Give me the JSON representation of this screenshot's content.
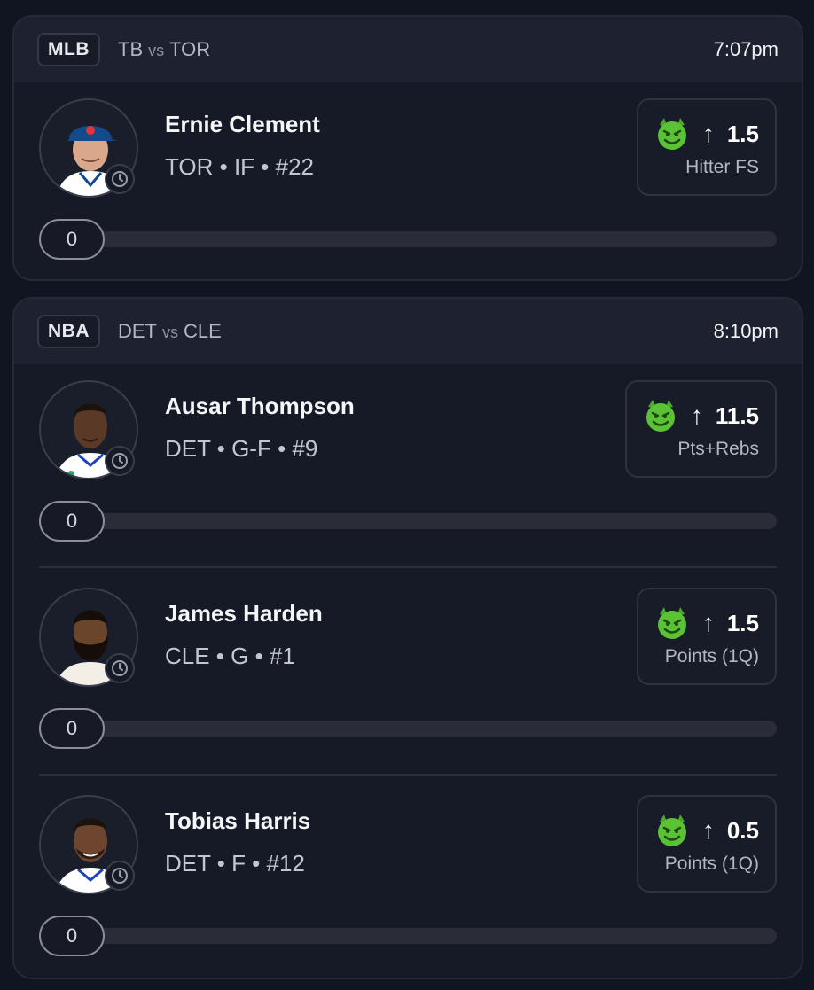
{
  "games": [
    {
      "league": "MLB",
      "team_a": "TB",
      "vs": "vs",
      "team_b": "TOR",
      "time": "7:07pm",
      "players": [
        {
          "name": "Ernie Clement",
          "info": "TOR • IF • #22",
          "pick_direction_icon": "arrow-up-icon",
          "pick_line": "1.5",
          "pick_stat": "Hitter FS",
          "progress_value": "0",
          "progress_fraction": 0,
          "jersey_color": "#ffffff",
          "cap_color": "#134a8e"
        }
      ]
    },
    {
      "league": "NBA",
      "team_a": "DET",
      "vs": "vs",
      "team_b": "CLE",
      "time": "8:10pm",
      "players": [
        {
          "name": "Ausar Thompson",
          "info": "DET • G-F • #9",
          "pick_direction_icon": "arrow-up-icon",
          "pick_line": "11.5",
          "pick_stat": "Pts+Rebs",
          "progress_value": "0",
          "progress_fraction": 0,
          "jersey_color": "#ffffff"
        },
        {
          "name": "James Harden",
          "info": "CLE • G • #1",
          "pick_direction_icon": "arrow-up-icon",
          "pick_line": "1.5",
          "pick_stat": "Points (1Q)",
          "progress_value": "0",
          "progress_fraction": 0,
          "jersey_color": "#f3efe6"
        },
        {
          "name": "Tobias Harris",
          "info": "DET • F • #12",
          "pick_direction_icon": "arrow-up-icon",
          "pick_line": "0.5",
          "pick_stat": "Points (1Q)",
          "progress_value": "0",
          "progress_fraction": 0,
          "jersey_color": "#ffffff"
        }
      ]
    }
  ],
  "colors": {
    "background": "#111521",
    "card": "#161a27",
    "header": "#1e2230",
    "demon_green": "#5bc236",
    "progress_track": "#2a2d38"
  },
  "icons": {
    "pick_badge": "demon-face-icon",
    "status": "clock-icon"
  }
}
